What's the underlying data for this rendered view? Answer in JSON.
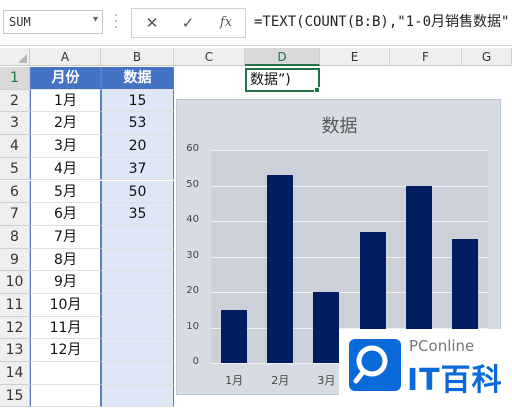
{
  "formula_bar": {
    "name_box": "SUM",
    "formula": "=TEXT(COUNT(B:B),\"1-0月销售数据\""
  },
  "columns": [
    "A",
    "B",
    "C",
    "D",
    "E",
    "F",
    "G"
  ],
  "rows": [
    "1",
    "2",
    "3",
    "4",
    "5",
    "6",
    "7",
    "8",
    "9",
    "10",
    "11",
    "12",
    "13",
    "14",
    "15"
  ],
  "table": {
    "header": [
      "月份",
      "数据"
    ],
    "months": [
      "1月",
      "2月",
      "3月",
      "4月",
      "5月",
      "6月",
      "7月",
      "8月",
      "9月",
      "10月",
      "11月",
      "12月"
    ],
    "values": [
      "15",
      "53",
      "20",
      "37",
      "50",
      "35",
      "",
      "",
      "",
      "",
      "",
      ""
    ]
  },
  "active_cell": {
    "address": "D1",
    "text": "数据”)"
  },
  "chart_data": {
    "type": "bar",
    "title": "数据",
    "categories": [
      "1月",
      "2月",
      "3月",
      "4月",
      "5月",
      "6月"
    ],
    "values": [
      15,
      53,
      20,
      37,
      50,
      35
    ],
    "ylim": [
      0,
      60
    ],
    "yticks": [
      0,
      10,
      20,
      30,
      40,
      50,
      60
    ],
    "grid": true,
    "bar_color": "#001e5f"
  },
  "watermark": {
    "top_text": "PConline",
    "brand_text": "IT百科"
  },
  "colors": {
    "header_fill": "#4472c4",
    "column_fill": "#dde7f5",
    "active_border": "#217346"
  }
}
